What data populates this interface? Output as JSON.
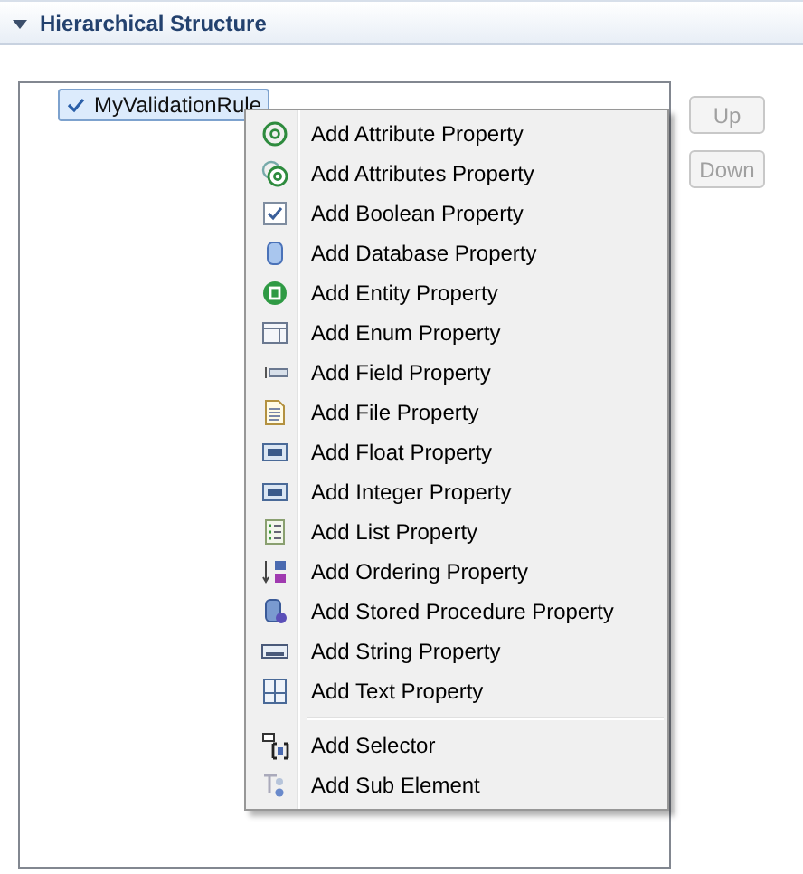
{
  "section": {
    "title": "Hierarchical Structure",
    "expanded": true
  },
  "tree": {
    "items": [
      {
        "label": "MyValidationRule",
        "selected": true
      }
    ]
  },
  "buttons": [
    {
      "label": "Up",
      "disabled": true
    },
    {
      "label": "Down",
      "disabled": true
    }
  ],
  "context_menu": {
    "groups": [
      [
        {
          "label": "Add Attribute Property"
        },
        {
          "label": "Add Attributes Property"
        },
        {
          "label": "Add Boolean Property"
        },
        {
          "label": "Add Database Property"
        },
        {
          "label": "Add Entity Property"
        },
        {
          "label": "Add Enum Property"
        },
        {
          "label": "Add Field Property"
        },
        {
          "label": "Add File Property"
        },
        {
          "label": "Add Float Property"
        },
        {
          "label": "Add Integer Property"
        },
        {
          "label": "Add List Property"
        },
        {
          "label": "Add Ordering Property"
        },
        {
          "label": "Add Stored Procedure Property"
        },
        {
          "label": "Add String Property"
        },
        {
          "label": "Add Text Property"
        }
      ],
      [
        {
          "label": "Add Selector"
        },
        {
          "label": "Add Sub Element"
        }
      ]
    ]
  }
}
